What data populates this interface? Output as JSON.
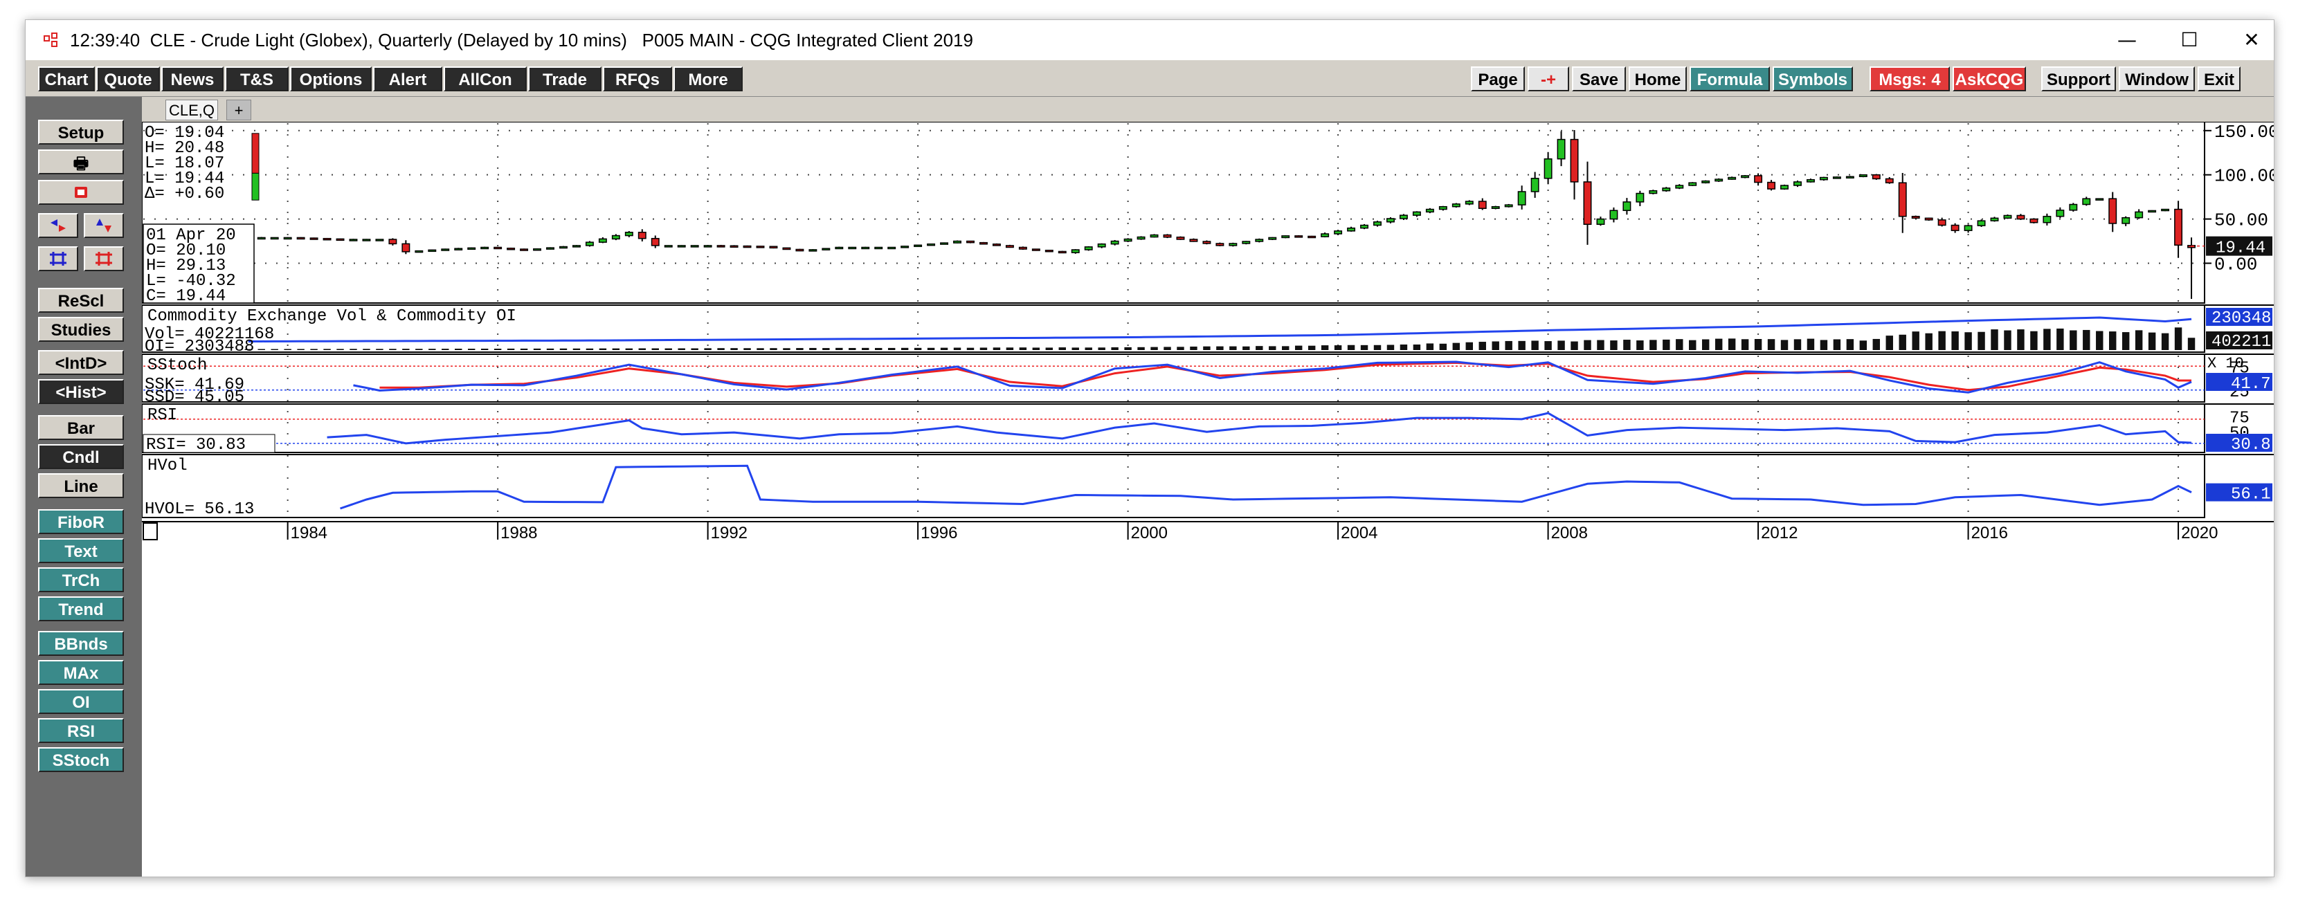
{
  "window": {
    "time": "12:39:40",
    "title": "CLE - Crude Light (Globex), Quarterly (Delayed by 10 mins)   P005 MAIN - CQG Integrated Client 2019",
    "controls": {
      "minimize": "—",
      "maximize": "☐",
      "close": "✕"
    }
  },
  "toolbar": {
    "left": [
      "Chart",
      "Quote",
      "News",
      "T&S",
      "Options",
      "Alert",
      "AllCon",
      "Trade",
      "RFQs",
      "More"
    ],
    "right": {
      "page": "Page",
      "pm": "-+",
      "save": "Save",
      "home": "Home",
      "formula": "Formula",
      "symbols": "Symbols",
      "msgs": "Msgs: 4",
      "askcqg": "AskCQG",
      "support": "Support",
      "window": "Window",
      "exit": "Exit",
      "restore": "🗗",
      "help": "?"
    }
  },
  "sidebar": {
    "setup": "Setup",
    "print": "🖶",
    "rescale": "ReScl",
    "studies": "Studies",
    "intd": "<IntD>",
    "hist": "<Hist>",
    "bar": "Bar",
    "cndl": "Cndl",
    "line": "Line",
    "fibor": "FiboR",
    "text": "Text",
    "trch": "TrCh",
    "trend": "Trend",
    "bbnds": "BBnds",
    "max": "MAx",
    "oi": "OI",
    "rsi": "RSI",
    "sstoch": "SStoch"
  },
  "tabs": {
    "symbol": "CLE,Q",
    "add": "+"
  },
  "colors": {
    "up": "#22c022",
    "down": "#dd2222",
    "blue": "#2244ee",
    "red_line": "#ee2222",
    "vol": "#111111",
    "price_label": "#111111",
    "study_label": "#1a3bd6"
  },
  "chart_data": {
    "type": "candlestick",
    "x": {
      "range": [
        1981.25,
        2020.5
      ],
      "ticks": [
        1984,
        1988,
        1992,
        1996,
        2000,
        2004,
        2008,
        2012,
        2016,
        2020
      ],
      "tick_labels": [
        "1984",
        "1988",
        "1992",
        "1996",
        "2000",
        "2004",
        "2008",
        "2012",
        "2016",
        "2020"
      ]
    },
    "price": {
      "ylim": [
        -45,
        160
      ],
      "ticks": [
        0,
        50,
        100,
        150
      ],
      "tick_labels": [
        "0.00",
        "50.00",
        "100.00",
        "150.00"
      ],
      "last_label": "19.44",
      "legend_ohlc": {
        "O": "O=   19.04",
        "H": "H=   20.48",
        "L": "L=   18.07",
        "L2": "L=   19.44",
        "D": "Δ=   +0.60"
      },
      "cursor_box": {
        "date": "01 Apr 20",
        "O": "O=    20.10",
        "H": "H=    29.13",
        "L": "L=   -40.32",
        "C": "C=    19.44"
      },
      "mini_candle": {
        "open": 19.04,
        "high": 20.48,
        "low": 18.07,
        "close": 19.44
      },
      "quarterly_close_anchors": [
        [
          1983.25,
          29
        ],
        [
          1984.0,
          29
        ],
        [
          1985.0,
          27
        ],
        [
          1985.75,
          27
        ],
        [
          1986.0,
          22
        ],
        [
          1986.25,
          13
        ],
        [
          1987.0,
          16
        ],
        [
          1987.75,
          18
        ],
        [
          1988.5,
          15
        ],
        [
          1989.5,
          20
        ],
        [
          1990.5,
          35
        ],
        [
          1990.75,
          28
        ],
        [
          1991.0,
          20
        ],
        [
          1992.0,
          20
        ],
        [
          1993.0,
          19
        ],
        [
          1993.75,
          14
        ],
        [
          1994.5,
          18
        ],
        [
          1995.5,
          18
        ],
        [
          1996.5,
          23
        ],
        [
          1996.75,
          25
        ],
        [
          1997.5,
          20
        ],
        [
          1998.0,
          16
        ],
        [
          1998.75,
          12
        ],
        [
          1999.75,
          25
        ],
        [
          2000.5,
          32
        ],
        [
          2001.0,
          27
        ],
        [
          2001.75,
          20
        ],
        [
          2002.5,
          27
        ],
        [
          2003.0,
          31
        ],
        [
          2003.5,
          30
        ],
        [
          2004.5,
          43
        ],
        [
          2005.5,
          58
        ],
        [
          2006.5,
          70
        ],
        [
          2006.75,
          62
        ],
        [
          2007.25,
          66
        ],
        [
          2007.75,
          96
        ],
        [
          2008.25,
          140
        ],
        [
          2008.75,
          44
        ],
        [
          2009.0,
          50
        ],
        [
          2009.75,
          79
        ],
        [
          2010.75,
          91
        ],
        [
          2011.25,
          95
        ],
        [
          2011.75,
          99
        ],
        [
          2012.25,
          84
        ],
        [
          2012.75,
          92
        ],
        [
          2013.25,
          97
        ],
        [
          2013.75,
          98
        ],
        [
          2014.0,
          100
        ],
        [
          2014.5,
          91
        ],
        [
          2014.75,
          53
        ],
        [
          2015.25,
          49
        ],
        [
          2015.75,
          37
        ],
        [
          2016.25,
          48
        ],
        [
          2016.75,
          54
        ],
        [
          2017.25,
          46
        ],
        [
          2017.75,
          60
        ],
        [
          2018.25,
          73
        ],
        [
          2018.5,
          73
        ],
        [
          2018.75,
          45
        ],
        [
          2019.25,
          58
        ],
        [
          2019.75,
          61
        ],
        [
          2020.0,
          20.48
        ],
        [
          2020.25,
          19.44
        ]
      ],
      "last_quarter": {
        "open": 20.1,
        "high": 29.13,
        "low": -40.32,
        "close": 19.44
      }
    },
    "volume_oi": {
      "title": "Commodity Exchange Vol & Commodity OI",
      "vol_label": "Vol=    40221168",
      "oi_label": "OI=     2303488",
      "right_top": "230348",
      "right_bottom": "402211",
      "scale_note": "X 10",
      "oi_anchors": [
        [
          1983.25,
          0.25
        ],
        [
          1990.0,
          0.28
        ],
        [
          2000.0,
          0.38
        ],
        [
          2004.0,
          0.45
        ],
        [
          2008.0,
          0.6
        ],
        [
          2012.0,
          0.72
        ],
        [
          2016.0,
          0.9
        ],
        [
          2018.5,
          1.0
        ],
        [
          2019.75,
          0.88
        ],
        [
          2020.25,
          0.95
        ]
      ],
      "vol_anchors": [
        [
          1983.25,
          0.01
        ],
        [
          1990.0,
          0.03
        ],
        [
          2000.0,
          0.07
        ],
        [
          2005.0,
          0.15
        ],
        [
          2007.0,
          0.26
        ],
        [
          2009.0,
          0.3
        ],
        [
          2012.0,
          0.35
        ],
        [
          2014.0,
          0.32
        ],
        [
          2015.0,
          0.58
        ],
        [
          2018.0,
          0.68
        ],
        [
          2019.75,
          0.58
        ],
        [
          2020.0,
          0.8
        ],
        [
          2020.25,
          0.4
        ]
      ]
    },
    "sstoch": {
      "title": "SStoch",
      "ssk_label": "SSK=        41.69",
      "ssd_label": "SSD=        45.05",
      "ticks": [
        25,
        75
      ],
      "tick_labels": [
        "25",
        "75"
      ],
      "right_label": "41.7",
      "ylim": [
        0,
        100
      ],
      "upper_band": 75,
      "lower_band": 25,
      "ssk_anchors": [
        [
          1985.25,
          35
        ],
        [
          1985.75,
          24
        ],
        [
          1986.5,
          28
        ],
        [
          1987.5,
          36
        ],
        [
          1988.5,
          35
        ],
        [
          1989.5,
          55
        ],
        [
          1990.5,
          78
        ],
        [
          1991.5,
          58
        ],
        [
          1992.5,
          37
        ],
        [
          1993.5,
          26
        ],
        [
          1994.5,
          40
        ],
        [
          1995.5,
          57
        ],
        [
          1996.75,
          74
        ],
        [
          1997.75,
          34
        ],
        [
          1998.75,
          29
        ],
        [
          1999.75,
          70
        ],
        [
          2000.75,
          78
        ],
        [
          2001.75,
          50
        ],
        [
          2002.75,
          63
        ],
        [
          2003.75,
          70
        ],
        [
          2004.75,
          82
        ],
        [
          2006.25,
          84
        ],
        [
          2007.25,
          73
        ],
        [
          2008.0,
          83
        ],
        [
          2008.75,
          46
        ],
        [
          2010.0,
          38
        ],
        [
          2011.0,
          50
        ],
        [
          2011.75,
          64
        ],
        [
          2012.75,
          61
        ],
        [
          2013.75,
          65
        ],
        [
          2014.5,
          45
        ],
        [
          2015.25,
          28
        ],
        [
          2016.0,
          20
        ],
        [
          2016.75,
          40
        ],
        [
          2017.75,
          60
        ],
        [
          2018.5,
          83
        ],
        [
          2019.0,
          64
        ],
        [
          2019.75,
          47
        ],
        [
          2020.0,
          30
        ],
        [
          2020.25,
          42
        ]
      ],
      "ssd_anchors": [
        [
          1985.75,
          30
        ],
        [
          1986.5,
          30
        ],
        [
          1987.5,
          36
        ],
        [
          1988.5,
          38
        ],
        [
          1989.5,
          51
        ],
        [
          1990.5,
          70
        ],
        [
          1991.5,
          58
        ],
        [
          1992.5,
          40
        ],
        [
          1993.5,
          32
        ],
        [
          1994.5,
          39
        ],
        [
          1995.5,
          55
        ],
        [
          1996.75,
          69
        ],
        [
          1997.75,
          42
        ],
        [
          1998.75,
          33
        ],
        [
          1999.75,
          60
        ],
        [
          2000.75,
          74
        ],
        [
          2001.75,
          55
        ],
        [
          2002.75,
          60
        ],
        [
          2003.75,
          67
        ],
        [
          2004.75,
          78
        ],
        [
          2006.25,
          82
        ],
        [
          2007.25,
          76
        ],
        [
          2008.0,
          80
        ],
        [
          2008.75,
          55
        ],
        [
          2010.0,
          42
        ],
        [
          2011.0,
          48
        ],
        [
          2011.75,
          60
        ],
        [
          2012.75,
          62
        ],
        [
          2013.75,
          63
        ],
        [
          2014.5,
          52
        ],
        [
          2015.25,
          36
        ],
        [
          2016.0,
          25
        ],
        [
          2016.75,
          32
        ],
        [
          2017.75,
          55
        ],
        [
          2018.5,
          72
        ],
        [
          2019.0,
          68
        ],
        [
          2019.75,
          55
        ],
        [
          2020.0,
          45
        ],
        [
          2020.25,
          45
        ]
      ]
    },
    "rsi": {
      "title": "RSI",
      "rsi_label": "RSI=    30.83",
      "ticks": [
        50,
        75
      ],
      "tick_labels": [
        "50",
        "75"
      ],
      "right_label": "30.8",
      "ylim": [
        15,
        95
      ],
      "upper_band": 70,
      "lower_band": 30,
      "anchors": [
        [
          1984.75,
          40
        ],
        [
          1985.5,
          44
        ],
        [
          1986.25,
          30
        ],
        [
          1987.0,
          36
        ],
        [
          1988.0,
          42
        ],
        [
          1989.0,
          48
        ],
        [
          1990.5,
          68
        ],
        [
          1990.75,
          55
        ],
        [
          1991.5,
          45
        ],
        [
          1992.5,
          48
        ],
        [
          1993.75,
          38
        ],
        [
          1994.5,
          45
        ],
        [
          1995.5,
          47
        ],
        [
          1996.75,
          58
        ],
        [
          1997.5,
          48
        ],
        [
          1998.75,
          38
        ],
        [
          1999.75,
          56
        ],
        [
          2000.5,
          63
        ],
        [
          2001.5,
          49
        ],
        [
          2002.5,
          58
        ],
        [
          2003.5,
          59
        ],
        [
          2004.5,
          64
        ],
        [
          2005.5,
          72
        ],
        [
          2006.5,
          72
        ],
        [
          2007.5,
          70
        ],
        [
          2008.0,
          80
        ],
        [
          2008.75,
          43
        ],
        [
          2009.5,
          52
        ],
        [
          2010.5,
          56
        ],
        [
          2011.5,
          54
        ],
        [
          2012.5,
          52
        ],
        [
          2013.5,
          55
        ],
        [
          2014.5,
          50
        ],
        [
          2015.0,
          34
        ],
        [
          2015.75,
          32
        ],
        [
          2016.5,
          44
        ],
        [
          2017.5,
          48
        ],
        [
          2018.5,
          60
        ],
        [
          2019.0,
          45
        ],
        [
          2019.75,
          50
        ],
        [
          2020.0,
          32
        ],
        [
          2020.25,
          31
        ]
      ]
    },
    "hvol": {
      "title": "HVol",
      "hvol_label": "HVOL=    56.13",
      "right_label": "56.1",
      "ylim": [
        0,
        140
      ],
      "anchors": [
        [
          1985.0,
          20
        ],
        [
          1985.5,
          40
        ],
        [
          1986.0,
          55
        ],
        [
          1987.5,
          58
        ],
        [
          1988.0,
          58
        ],
        [
          1988.5,
          35
        ],
        [
          1990.0,
          34
        ],
        [
          1990.25,
          112
        ],
        [
          1992.75,
          115
        ],
        [
          1993.0,
          40
        ],
        [
          1994.0,
          35
        ],
        [
          1996.0,
          35
        ],
        [
          1998.0,
          30
        ],
        [
          1999.0,
          50
        ],
        [
          2001.0,
          48
        ],
        [
          2002.0,
          40
        ],
        [
          2005.0,
          45
        ],
        [
          2007.5,
          35
        ],
        [
          2008.75,
          75
        ],
        [
          2009.5,
          80
        ],
        [
          2010.5,
          78
        ],
        [
          2011.5,
          42
        ],
        [
          2013.0,
          40
        ],
        [
          2014.0,
          28
        ],
        [
          2015.0,
          30
        ],
        [
          2015.75,
          45
        ],
        [
          2017.0,
          50
        ],
        [
          2018.5,
          28
        ],
        [
          2019.5,
          40
        ],
        [
          2020.0,
          70
        ],
        [
          2020.25,
          56
        ]
      ]
    }
  }
}
